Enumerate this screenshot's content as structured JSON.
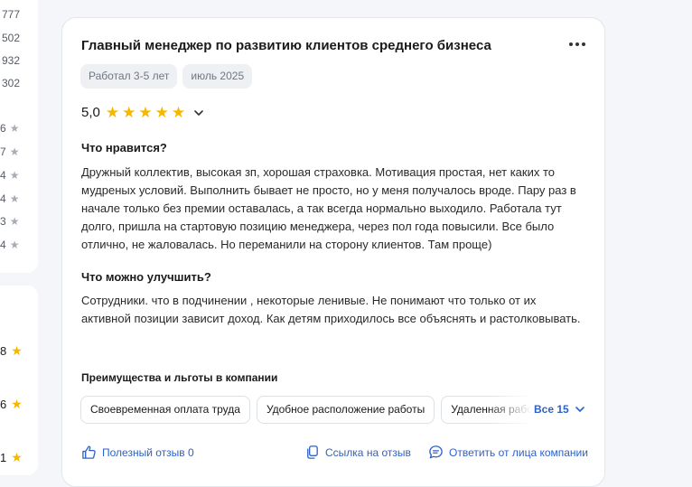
{
  "sidebar": {
    "counts": [
      "777",
      "502",
      "932",
      "302"
    ],
    "ratings": [
      "6",
      "7",
      "4",
      "4",
      "3",
      "4"
    ],
    "scores": [
      "8",
      "6",
      "1"
    ]
  },
  "review": {
    "title": "Главный менеджер по развитию клиентов среднего бизнеса",
    "tags": [
      "Работал 3-5 лет",
      "июль 2025"
    ],
    "rating": "5,0",
    "stars": 5,
    "likes_heading": "Что нравится?",
    "likes_text": "Дружный коллектив, высокая зп, хорошая страховка. Мотивация простая, нет каких то мудреных условий. Выполнить бывает не просто, но у меня получалось вроде. Пару раз в начале только без премии оставалась, а так всегда нормально выходило. Работала тут долго, пришла на стартовую позицию менеджера, через пол года повысили. Все было отлично, не жаловалась. Но переманили на сторону клиентов. Там проще)",
    "improve_heading": "Что можно улучшить?",
    "improve_text": "Сотрудники. что в подчинении , некоторые ленивые. Не понимают что только от их активной позиции зависит доход. Как детям приходилось все объяснять и растолковывать.",
    "benefits_heading": "Преимущества и льготы в компании",
    "benefits": [
      "Своевременная оплата труда",
      "Удобное расположение работы",
      "Удаленная работа"
    ],
    "benefits_all": "Все 15",
    "actions": {
      "helpful": "Полезный отзыв 0",
      "link": "Ссылка на отзыв",
      "reply": "Ответить от лица компании"
    }
  },
  "colors": {
    "accent": "#2c62c8",
    "star": "#f6b700",
    "tag_bg": "#eef0f3"
  }
}
